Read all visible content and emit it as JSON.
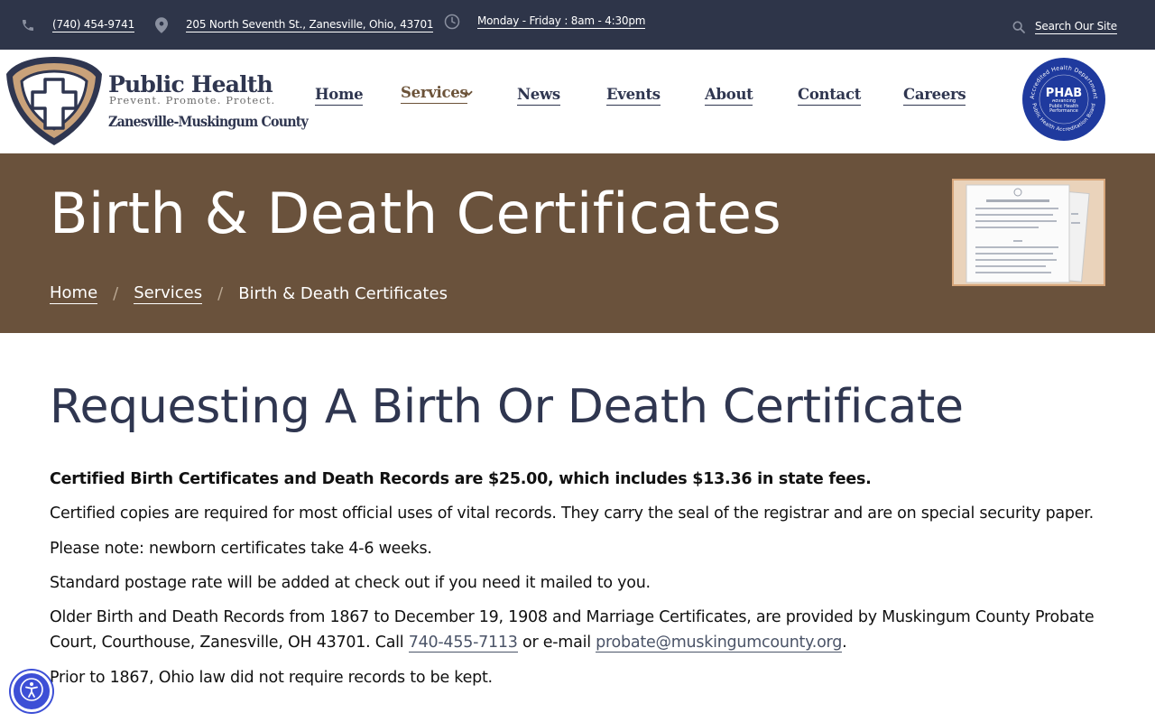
{
  "topbar": {
    "phone": "(740) 454-9741",
    "address": "205 North Seventh St., Zanesville, Ohio, 43701",
    "hours": "Monday - Friday : 8am - 4:30pm",
    "search_label": "Search Our Site"
  },
  "logo": {
    "line1": "Public Health",
    "line2": "Prevent. Promote. Protect.",
    "line3": "Zanesville-Muskingum County"
  },
  "nav": {
    "items": [
      {
        "label": "Home"
      },
      {
        "label": "Services",
        "active": true
      },
      {
        "label": "News"
      },
      {
        "label": "Events"
      },
      {
        "label": "About"
      },
      {
        "label": "Contact"
      },
      {
        "label": "Careers"
      }
    ]
  },
  "phab_badge": {
    "name": "PHAB",
    "arc_top": "Accredited Health Department",
    "arc_bottom": "Public Health Accreditation Board",
    "tagline": "Advancing Public Health Performance"
  },
  "banner": {
    "title": "Birth & Death Certificates",
    "breadcrumb": [
      "Home",
      "Services",
      "Birth & Death Certificates"
    ],
    "separator": "/"
  },
  "content": {
    "heading": "Requesting A Birth Or Death Certificate",
    "fee_notice": "Certified Birth Certificates and Death Records are $25.00, which includes $13.36 in state fees.",
    "certified_copies": "Certified copies are required for most official uses of vital records. They carry the seal of the registrar and are on special security paper.",
    "newborn_note": "Please note: newborn certificates take 4-6 weeks.",
    "postage": "Standard postage rate will be added at check out if you need it mailed to you.",
    "older_records_pre": "Older Birth and Death Records from 1867 to December 19, 1908 and Marriage Certificates, are provided by Muskingum County Probate Court, Courthouse, Zanesville, OH 43701. Call ",
    "probate_phone": "740-455-7113",
    "older_records_mid": " or e-mail ",
    "probate_email": "probate@muskingumcounty.org",
    "older_records_end": ".",
    "pre_1867": "Prior to 1867, Ohio law did not require records to be kept."
  },
  "colors": {
    "topbar_bg": "#2e3549",
    "banner_bg": "#6a523c",
    "navy": "#2f3650",
    "brown_accent": "#6b5238",
    "accessibility_blue": "#3d4fd6"
  },
  "icons": [
    "phone-icon",
    "location-pin-icon",
    "clock-icon",
    "search-icon",
    "chevron-down-icon",
    "accessibility-icon"
  ]
}
